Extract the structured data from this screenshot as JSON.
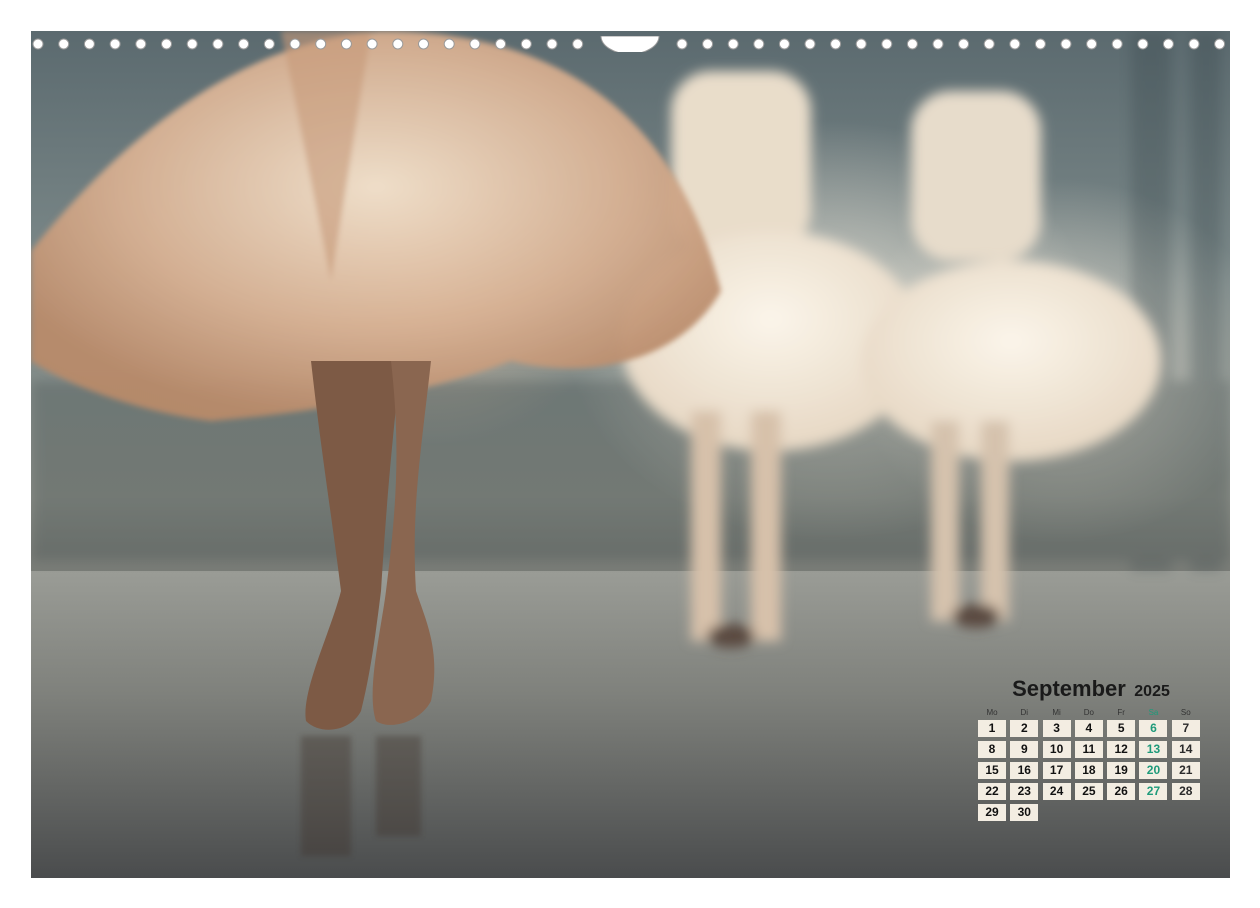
{
  "calendar": {
    "month": "September",
    "year": "2025",
    "weekdays": [
      "Mo",
      "Di",
      "Mi",
      "Do",
      "Fr",
      "Sa",
      "So"
    ],
    "leading_blanks": 0,
    "days": [
      "1",
      "2",
      "3",
      "4",
      "5",
      "6",
      "7",
      "8",
      "9",
      "10",
      "11",
      "12",
      "13",
      "14",
      "15",
      "16",
      "17",
      "18",
      "19",
      "20",
      "21",
      "22",
      "23",
      "24",
      "25",
      "26",
      "27",
      "28",
      "29",
      "30"
    ],
    "saturday_color": "#1e9a7a",
    "cell_color": "#f3ede2"
  },
  "photo": {
    "subject": "ballet-dancers-photo"
  },
  "binding": {
    "hole_count_left": 22,
    "hole_count_right": 22
  }
}
